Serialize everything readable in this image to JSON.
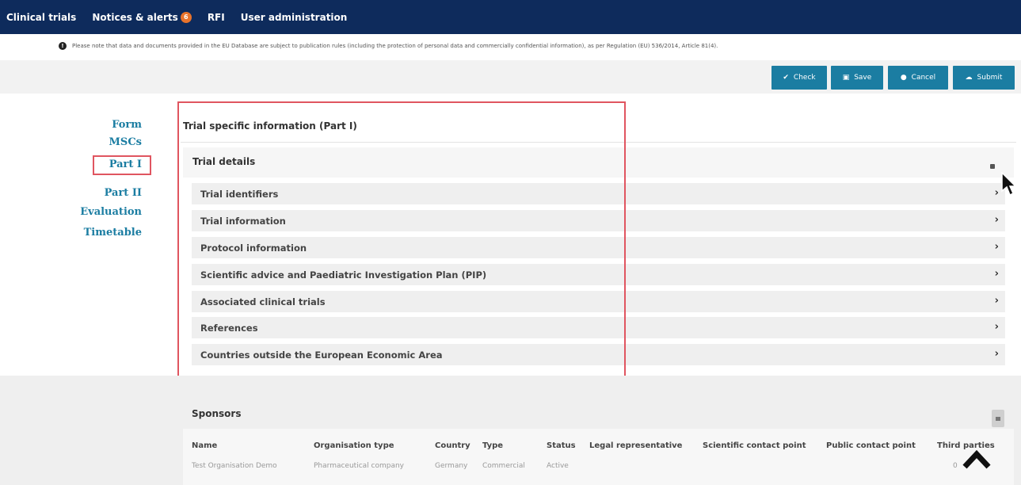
{
  "topnav": {
    "items": [
      {
        "label": "Clinical trials"
      },
      {
        "label": "Notices & alerts",
        "badge": "6"
      },
      {
        "label": "RFI"
      },
      {
        "label": "User administration"
      }
    ]
  },
  "notice": {
    "text": "Please note that data and documents provided in the EU Database are subject to publication rules (including the protection of personal data and commercially confidential information), as per Regulation (EU) 536/2014, Article 81(4)."
  },
  "toolbar": {
    "check": "Check",
    "save": "Save",
    "cancel": "Cancel",
    "submit": "Submit"
  },
  "leftmenu": {
    "items": [
      "Form",
      "MSCs",
      "Part I",
      "Part II",
      "Evaluation",
      "Timetable"
    ]
  },
  "main": {
    "section_title": "Trial specific information (Part I)",
    "trial_details": "Trial details",
    "rows": [
      "Trial identifiers",
      "Trial information",
      "Protocol information",
      "Scientific advice and Paediatric Investigation Plan (PIP)",
      "Associated clinical trials",
      "References",
      "Countries outside the European Economic Area"
    ]
  },
  "sponsors": {
    "title": "Sponsors",
    "columns": [
      "Name",
      "Organisation type",
      "Country",
      "Type",
      "Status",
      "Legal representative",
      "Scientific contact point",
      "Public contact point",
      "Third parties"
    ],
    "row": [
      "Test Organisation Demo",
      "Pharmaceutical company",
      "Germany",
      "Commercial",
      "Active",
      "",
      "",
      "",
      "0"
    ]
  },
  "colors": {
    "nav_bg": "#0e2b5c",
    "button_bg": "#1b7da2",
    "link": "#1b7da2",
    "highlight_border": "#e05560",
    "badge": "#e8732b"
  }
}
